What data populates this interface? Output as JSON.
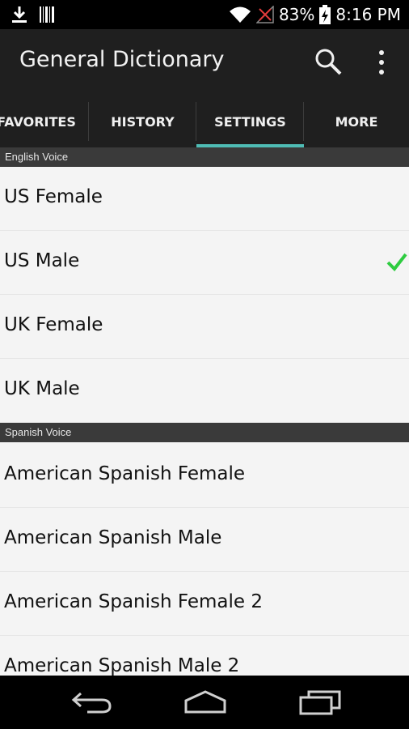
{
  "status_bar": {
    "battery_percent": "83%",
    "time": "8:16 PM",
    "icons": [
      "download-icon",
      "barcode-icon",
      "wifi-icon",
      "no-signal-icon",
      "battery-charging-icon"
    ]
  },
  "app_bar": {
    "title": "General Dictionary",
    "icons": [
      "search-icon",
      "overflow-menu-icon"
    ]
  },
  "tabs": [
    {
      "label": "FAVORITES",
      "selected": false
    },
    {
      "label": "HISTORY",
      "selected": false
    },
    {
      "label": "SETTINGS",
      "selected": true
    },
    {
      "label": "MORE",
      "selected": false
    }
  ],
  "accent_color": "#4fbcb5",
  "check_color": "#2ecc40",
  "english_voice": {
    "header": "English Voice",
    "options": [
      {
        "label": "US Female",
        "selected": false
      },
      {
        "label": "US Male",
        "selected": true
      },
      {
        "label": "UK Female",
        "selected": false
      },
      {
        "label": "UK Male",
        "selected": false
      }
    ]
  },
  "spanish_voice": {
    "header": "Spanish Voice",
    "options": [
      {
        "label": "American Spanish Female",
        "selected": false
      },
      {
        "label": "American Spanish Male",
        "selected": false
      },
      {
        "label": "American Spanish Female 2",
        "selected": false
      },
      {
        "label": "American Spanish Male 2",
        "selected": false
      }
    ]
  },
  "nav_bar": {
    "icons": [
      "back-icon",
      "home-icon",
      "recent-apps-icon"
    ]
  }
}
